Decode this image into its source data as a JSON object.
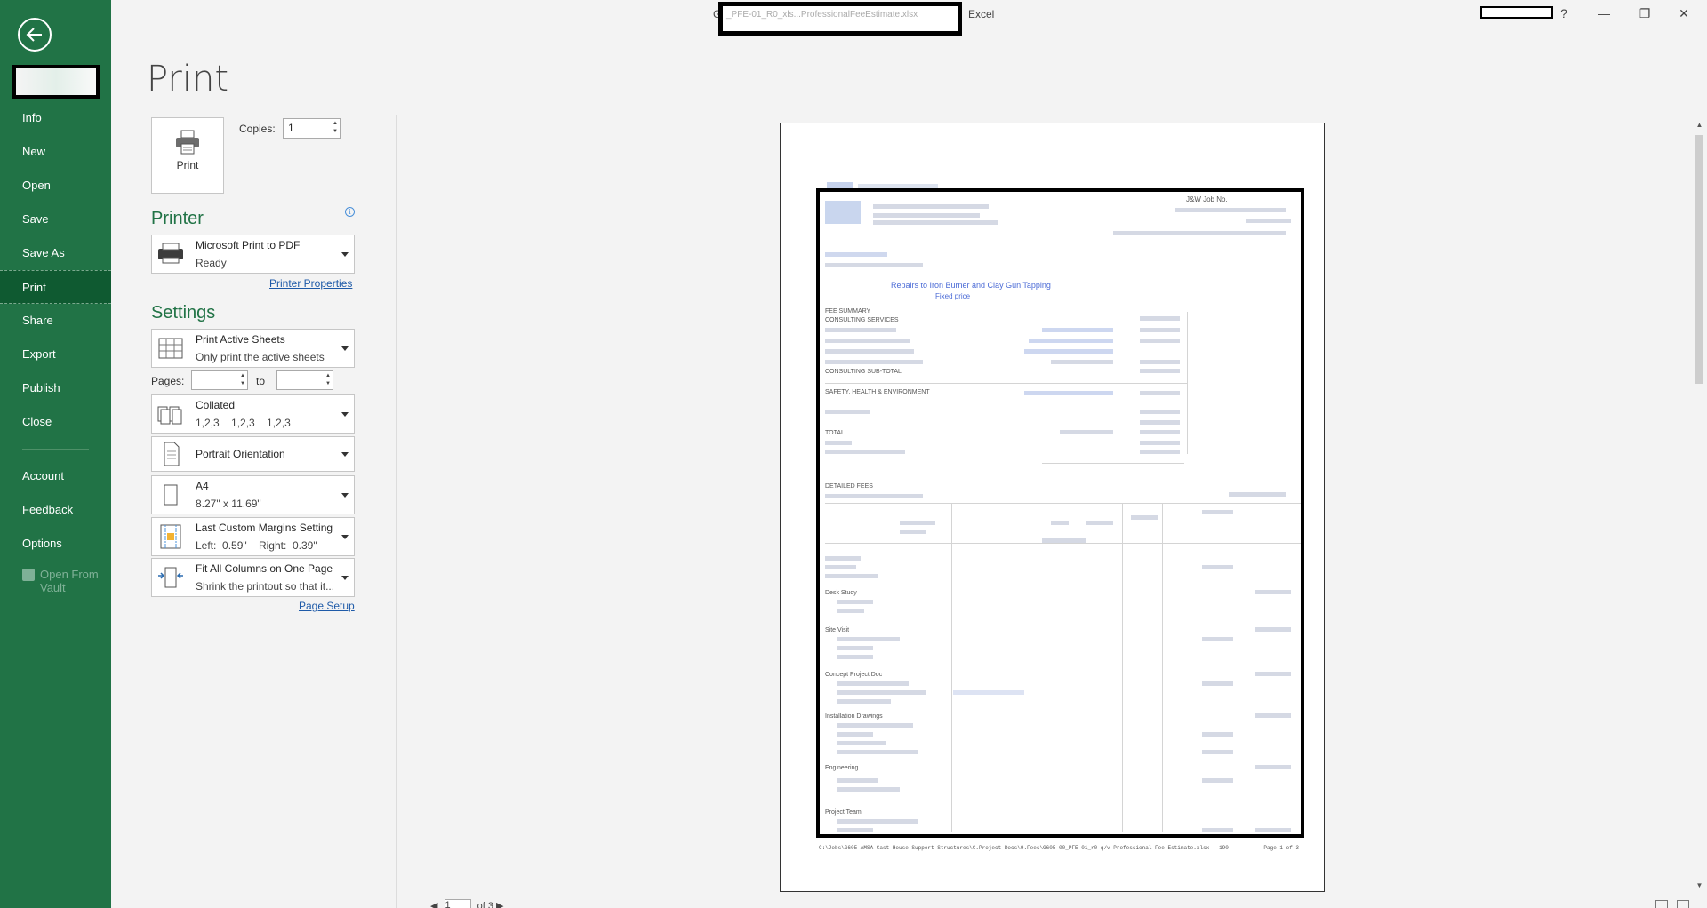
{
  "window": {
    "app_name": "Excel",
    "title_prefix": "G",
    "title_redacted_fragment": "_PFE-01_R0_xls...ProfessionalFeeEstimate.xlsx",
    "controls": {
      "help": "?",
      "minimize": "—",
      "restore": "❐",
      "close": "✕"
    }
  },
  "sidebar": {
    "items": [
      {
        "label": "Info"
      },
      {
        "label": "New"
      },
      {
        "label": "Open"
      },
      {
        "label": "Save"
      },
      {
        "label": "Save As"
      },
      {
        "label": "Print"
      },
      {
        "label": "Share"
      },
      {
        "label": "Export"
      },
      {
        "label": "Publish"
      },
      {
        "label": "Close"
      }
    ],
    "bottom_items": [
      {
        "label": "Account"
      },
      {
        "label": "Feedback"
      },
      {
        "label": "Options"
      },
      {
        "label": "Open From Vault"
      }
    ]
  },
  "page": {
    "title": "Print"
  },
  "print_button": {
    "label": "Print"
  },
  "copies": {
    "label": "Copies:",
    "value": "1"
  },
  "printer": {
    "section_title": "Printer",
    "name": "Microsoft Print to PDF",
    "status": "Ready",
    "properties_link": "Printer Properties"
  },
  "settings": {
    "section_title": "Settings",
    "what": {
      "title": "Print Active Sheets",
      "sub": "Only print the active sheets"
    },
    "pages": {
      "label": "Pages:",
      "to_label": "to",
      "from_value": "",
      "to_value": ""
    },
    "collation": {
      "title": "Collated",
      "sub": "1,2,3    1,2,3    1,2,3"
    },
    "orientation": {
      "title": "Portrait Orientation"
    },
    "paper": {
      "title": "A4",
      "sub": "8.27\" x 11.69\""
    },
    "margins": {
      "title": "Last Custom Margins Setting",
      "sub": "Left:  0.59\"    Right:  0.39\""
    },
    "scaling": {
      "title": "Fit All Columns on One Page",
      "sub": "Shrink the printout so that it..."
    },
    "page_setup_link": "Page Setup"
  },
  "preview": {
    "footer_path": "C:\\Jobs\\G605 AMSA Cast House Support Structures\\C.Project Docs\\9.Fees\\G605-00_PFE-01_r0 q/v Professional Fee Estimate.xlsx - 190",
    "footer_page": "Page 1 of 3",
    "doc_header_right": "J&W Job No.",
    "doc_title_line": "Repairs to Iron Burner and Clay Gun Tapping",
    "doc_sub": "Fixed price",
    "section_fee_summary": "FEE SUMMARY",
    "consulting_services": "CONSULTING SERVICES",
    "consulting_sub_total": "CONSULTING SUB-TOTAL",
    "she": "SAFETY, HEALTH & ENVIRONMENT",
    "total": "TOTAL",
    "detailed_fees": "DETAILED FEES",
    "row_labels": [
      "Desk Study",
      "Site Visit",
      "Concept Project Doc",
      "Installation Drawings",
      "Engineering",
      "Project Team"
    ]
  },
  "pager": {
    "current": "1",
    "of": "of 3"
  }
}
